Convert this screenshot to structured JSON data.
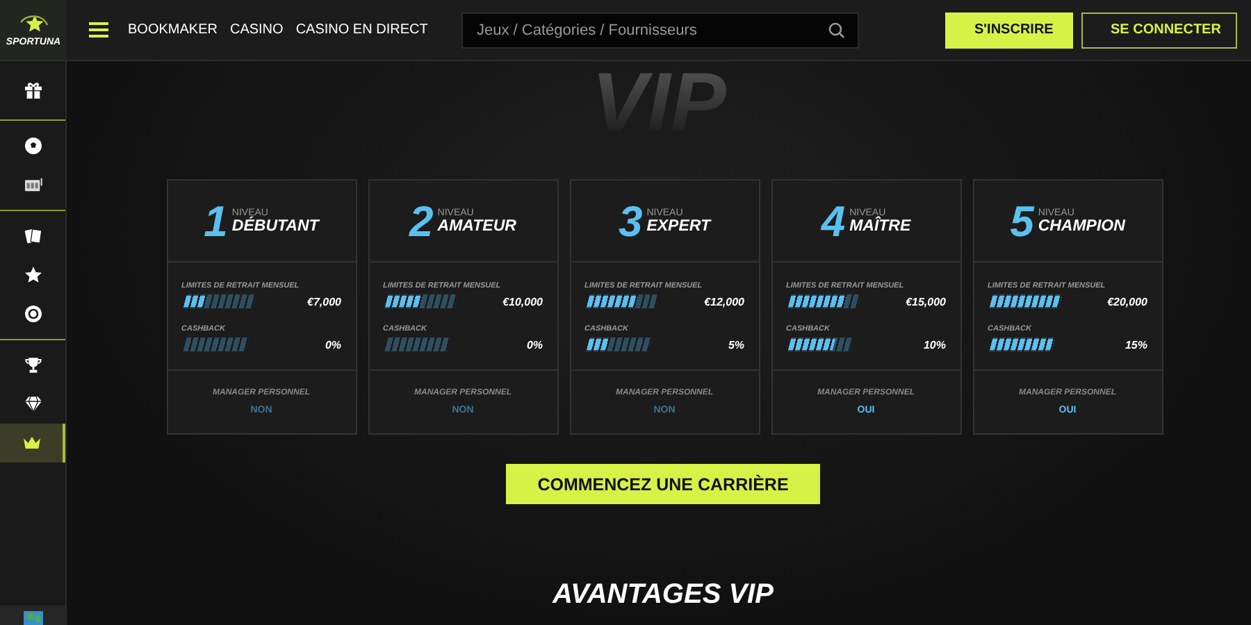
{
  "brand": {
    "name": "SPORTUNA"
  },
  "nav": {
    "links": [
      "BOOKMAKER",
      "CASINO",
      "CASINO EN DIRECT"
    ]
  },
  "search": {
    "placeholder": "Jeux / Catégories / Fournisseurs"
  },
  "buttons": [
    {
      "label": "S'INSCRIRE",
      "kind": "primary"
    },
    {
      "label": "SE CONNECTER",
      "kind": "outline"
    }
  ],
  "sidebar": {
    "groups": [
      [
        {
          "kind": "gift",
          "selected": false
        }
      ],
      [
        {
          "kind": "ball",
          "selected": false
        },
        {
          "kind": "slot",
          "selected": false
        }
      ],
      [
        {
          "kind": "cards",
          "selected": false
        },
        {
          "kind": "star",
          "selected": false
        },
        {
          "kind": "chip",
          "selected": false
        }
      ],
      [
        {
          "kind": "trophy",
          "selected": false
        },
        {
          "kind": "diamond",
          "selected": false
        },
        {
          "kind": "crown",
          "selected": true
        }
      ]
    ]
  },
  "hero_title": "VIP",
  "levels": [
    {
      "number": "1",
      "caption": "NIVEAU",
      "name": "DÉBUTANT",
      "withdrawal_label": "LIMITES DE RETRAIT MENSUEL",
      "withdrawal": {
        "level": 0.3,
        "reading": "€7,000"
      },
      "cashback_label": "CASHBACK",
      "cashback": {
        "level": 0,
        "reading": "0%"
      },
      "manager_label": "MANAGER PERSONNEL",
      "manager": {
        "value": "NON",
        "on": false
      }
    },
    {
      "number": "2",
      "caption": "NIVEAU",
      "name": "AMATEUR",
      "withdrawal_label": "LIMITES DE RETRAIT MENSUEL",
      "withdrawal": {
        "level": 0.5,
        "reading": "€10,000"
      },
      "cashback_label": "CASHBACK",
      "cashback": {
        "level": 0,
        "reading": "0%"
      },
      "manager_label": "MANAGER PERSONNEL",
      "manager": {
        "value": "NON",
        "on": false
      }
    },
    {
      "number": "3",
      "caption": "NIVEAU",
      "name": "EXPERT",
      "withdrawal_label": "LIMITES DE RETRAIT MENSUEL",
      "withdrawal": {
        "level": 0.7,
        "reading": "€12,000"
      },
      "cashback_label": "CASHBACK",
      "cashback": {
        "level": 0.3,
        "reading": "5%"
      },
      "manager_label": "MANAGER PERSONNEL",
      "manager": {
        "value": "NON",
        "on": false
      }
    },
    {
      "number": "4",
      "caption": "NIVEAU",
      "name": "MAÎTRE",
      "withdrawal_label": "LIMITES DE RETRAIT MENSUEL",
      "withdrawal": {
        "level": 0.8,
        "reading": "€15,000"
      },
      "cashback_label": "CASHBACK",
      "cashback": {
        "level": 0.7,
        "reading": "10%"
      },
      "manager_label": "MANAGER PERSONNEL",
      "manager": {
        "value": "OUI",
        "on": true
      }
    },
    {
      "number": "5",
      "caption": "NIVEAU",
      "name": "CHAMPION",
      "withdrawal_label": "LIMITES DE RETRAIT MENSUEL",
      "withdrawal": {
        "level": 1,
        "reading": "€20,000"
      },
      "cashback_label": "CASHBACK",
      "cashback": {
        "level": 1,
        "reading": "15%"
      },
      "manager_label": "MANAGER PERSONNEL",
      "manager": {
        "value": "OUI",
        "on": true
      }
    }
  ],
  "cta": {
    "label": "COMMENCEZ UNE CARRIÈRE"
  },
  "section_title": "AVANTAGES VIP"
}
